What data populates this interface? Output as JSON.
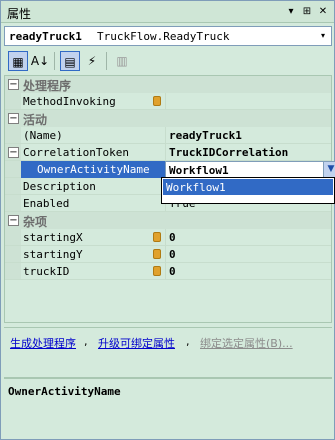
{
  "title": "属性",
  "title_controls": [
    "▾",
    "⊞",
    "✕"
  ],
  "selector": {
    "object_name": "readyTruck1",
    "object_type": "TruckFlow.ReadyTruck",
    "arrow": "▾"
  },
  "toolbar": {
    "buttons": [
      {
        "name": "categorized-icon",
        "glyph": "▦"
      },
      {
        "name": "alphabetical-icon",
        "glyph": "A↓"
      },
      {
        "name": "properties-icon",
        "glyph": "▤"
      },
      {
        "name": "events-icon",
        "glyph": "⚡"
      },
      {
        "name": "property-pages-icon",
        "glyph": "▥"
      }
    ]
  },
  "grid": {
    "categories": [
      {
        "label": "处理程序",
        "toggle": "−"
      },
      {
        "label": "活动",
        "toggle": "−"
      },
      {
        "label": "杂项",
        "toggle": "−"
      }
    ],
    "handlers": [
      {
        "name": "MethodInvoking",
        "value": ""
      }
    ],
    "activity": [
      {
        "name": "(Name)",
        "value": "readyTruck1"
      },
      {
        "name": "CorrelationToken",
        "value": "TruckIDCorrelation",
        "toggle": "−"
      },
      {
        "name": "OwnerActivityName",
        "value": "Workflow1"
      },
      {
        "name": "Description",
        "value": ""
      },
      {
        "name": "Enabled",
        "value": "True"
      }
    ],
    "misc": [
      {
        "name": "startingX",
        "value": "0"
      },
      {
        "name": "startingY",
        "value": "0"
      },
      {
        "name": "truckID",
        "value": "0"
      }
    ],
    "dropdown_arrow": "▼",
    "dropdown_options": [
      "Workflow1"
    ]
  },
  "commands": {
    "generate_handlers": "生成处理程序",
    "promote_bindable": "升级可绑定属性",
    "bind_selected": "绑定选定属性(B)..."
  },
  "description": {
    "title": "OwnerActivityName"
  }
}
